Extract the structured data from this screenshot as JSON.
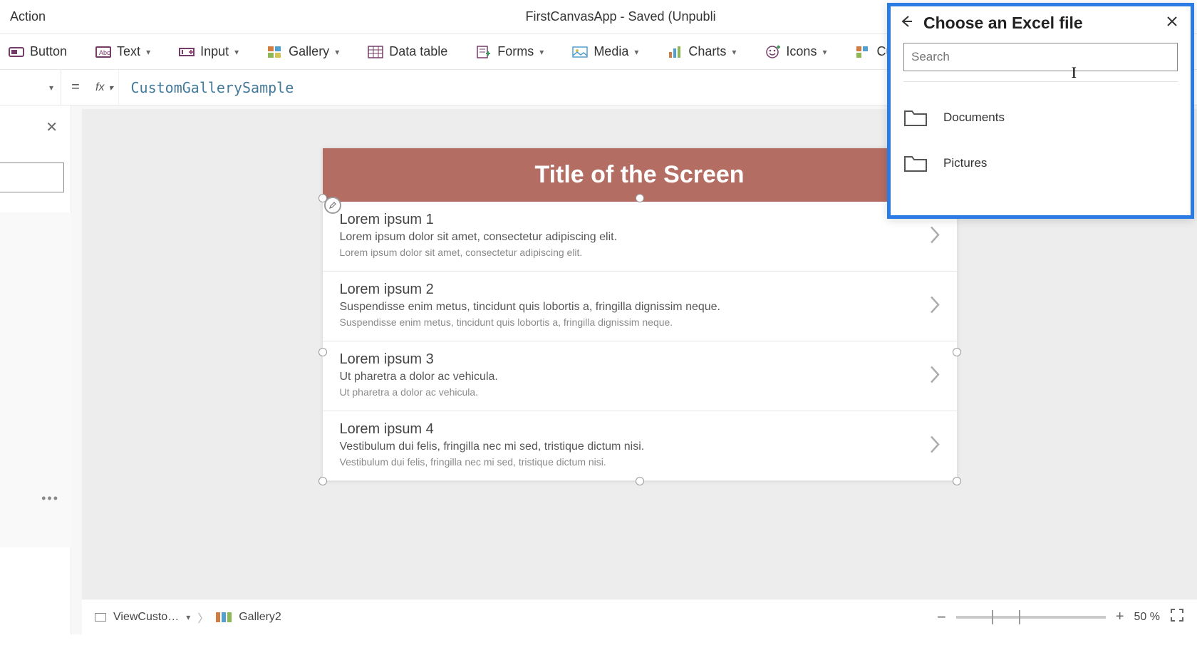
{
  "menubar": {
    "action_label": "Action",
    "title": "FirstCanvasApp - Saved (Unpubli"
  },
  "ribbon": {
    "button": "Button",
    "text": "Text",
    "input": "Input",
    "gallery": "Gallery",
    "datatable": "Data table",
    "forms": "Forms",
    "media": "Media",
    "charts": "Charts",
    "icons": "Icons",
    "custom": "Cu"
  },
  "formula": {
    "fx": "fx",
    "expr": "CustomGallerySample"
  },
  "screen": {
    "title": "Title of the Screen",
    "items": [
      {
        "title": "Lorem ipsum 1",
        "sub1": "Lorem ipsum dolor sit amet, consectetur adipiscing elit.",
        "sub2": "Lorem ipsum dolor sit amet, consectetur adipiscing elit."
      },
      {
        "title": "Lorem ipsum 2",
        "sub1": "Suspendisse enim metus, tincidunt quis lobortis a, fringilla dignissim neque.",
        "sub2": "Suspendisse enim metus, tincidunt quis lobortis a, fringilla dignissim neque."
      },
      {
        "title": "Lorem ipsum 3",
        "sub1": "Ut pharetra a dolor ac vehicula.",
        "sub2": "Ut pharetra a dolor ac vehicula."
      },
      {
        "title": "Lorem ipsum 4",
        "sub1": "Vestibulum dui felis, fringilla nec mi sed, tristique dictum nisi.",
        "sub2": "Vestibulum dui felis, fringilla nec mi sed, tristique dictum nisi."
      }
    ]
  },
  "statusbar": {
    "breadcrumb1": "ViewCusto…",
    "breadcrumb2": "Gallery2",
    "zoom": "50  %"
  },
  "flyout": {
    "title": "Choose an Excel file",
    "search_placeholder": "Search",
    "folders": [
      "Documents",
      "Pictures"
    ]
  }
}
